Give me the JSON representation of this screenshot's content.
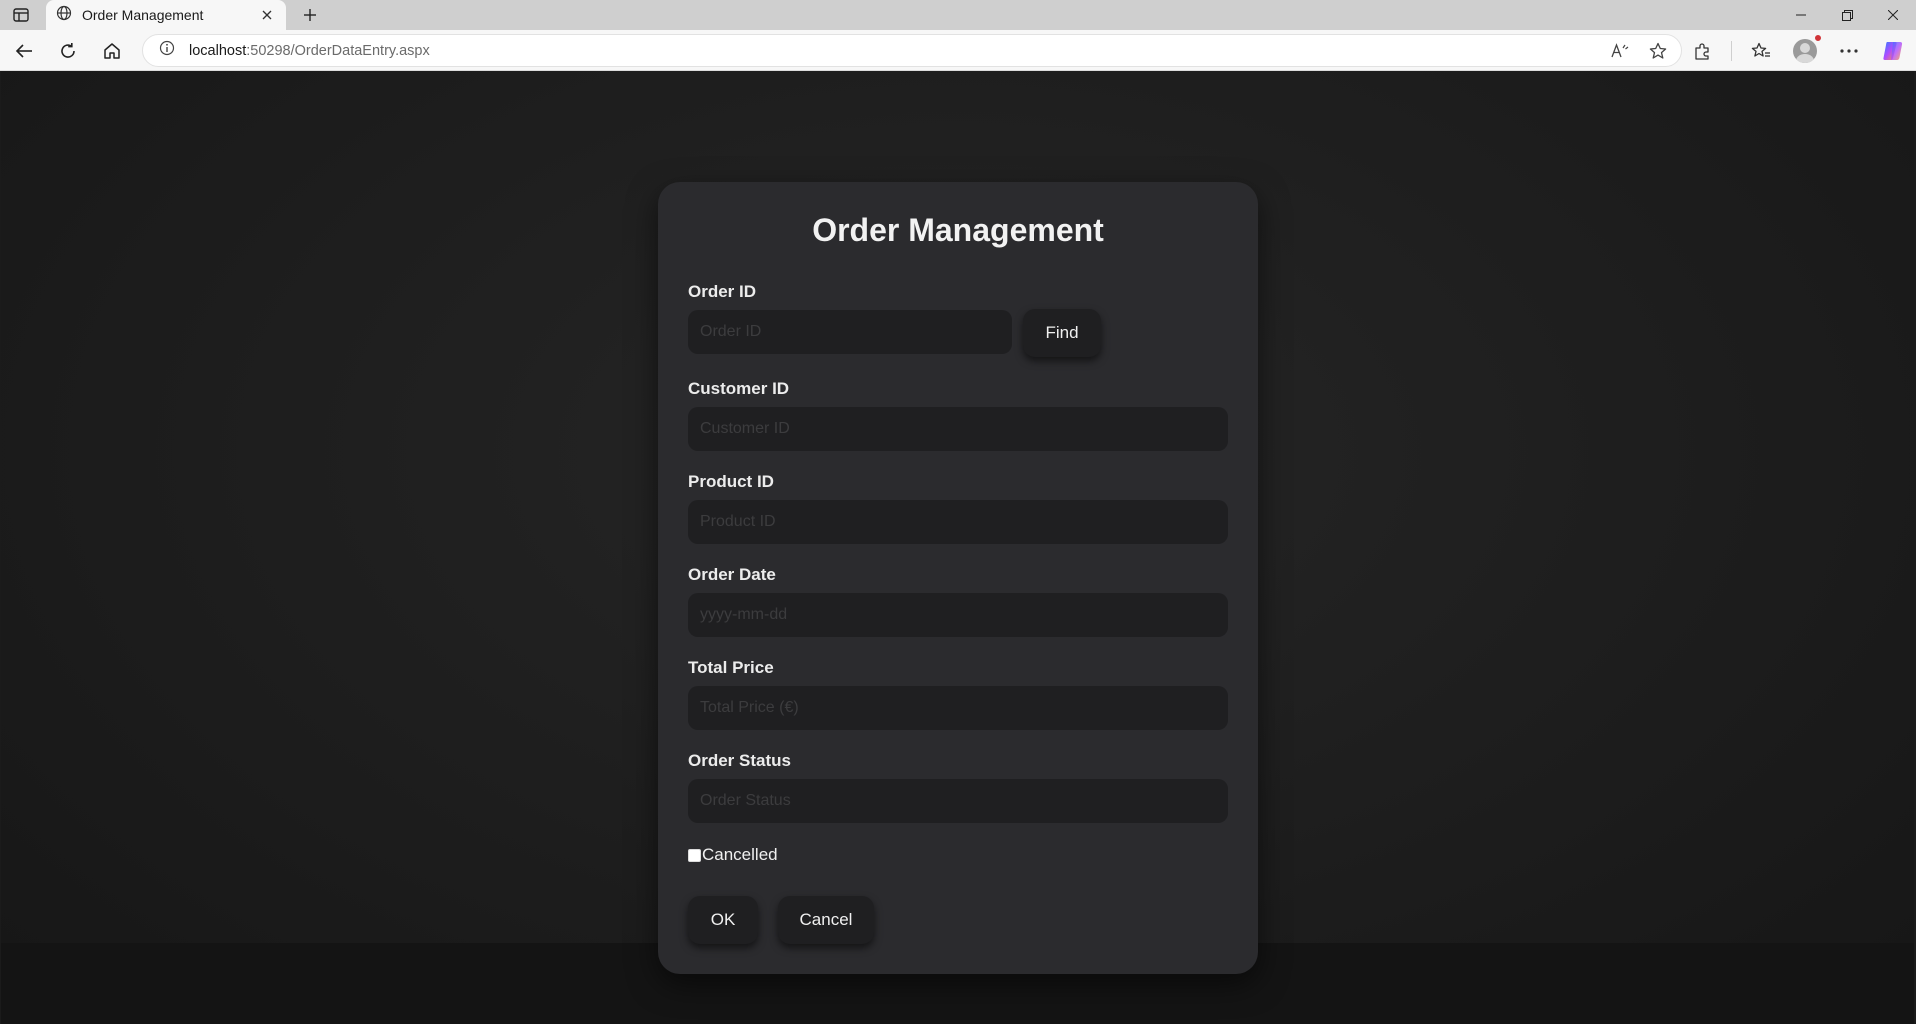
{
  "browser": {
    "tab_title": "Order Management",
    "url_host": "localhost",
    "url_rest": ":50298/OrderDataEntry.aspx"
  },
  "form": {
    "title": "Order Management",
    "order_id": {
      "label": "Order ID",
      "placeholder": "Order ID",
      "value": ""
    },
    "find_button": "Find",
    "customer_id": {
      "label": "Customer ID",
      "placeholder": "Customer ID",
      "value": ""
    },
    "product_id": {
      "label": "Product ID",
      "placeholder": "Product ID",
      "value": ""
    },
    "order_date": {
      "label": "Order Date",
      "placeholder": "yyyy-mm-dd",
      "value": ""
    },
    "total_price": {
      "label": "Total Price",
      "placeholder": "Total Price (€)",
      "value": ""
    },
    "order_status": {
      "label": "Order Status",
      "placeholder": "Order Status",
      "value": ""
    },
    "cancelled": {
      "label": "Cancelled",
      "checked": false
    },
    "ok_button": "OK",
    "cancel_button": "Cancel"
  },
  "colors": {
    "card_bg": "#2b2b2e",
    "input_bg": "#1f1f21",
    "page_bg": "#1e1e1e"
  }
}
